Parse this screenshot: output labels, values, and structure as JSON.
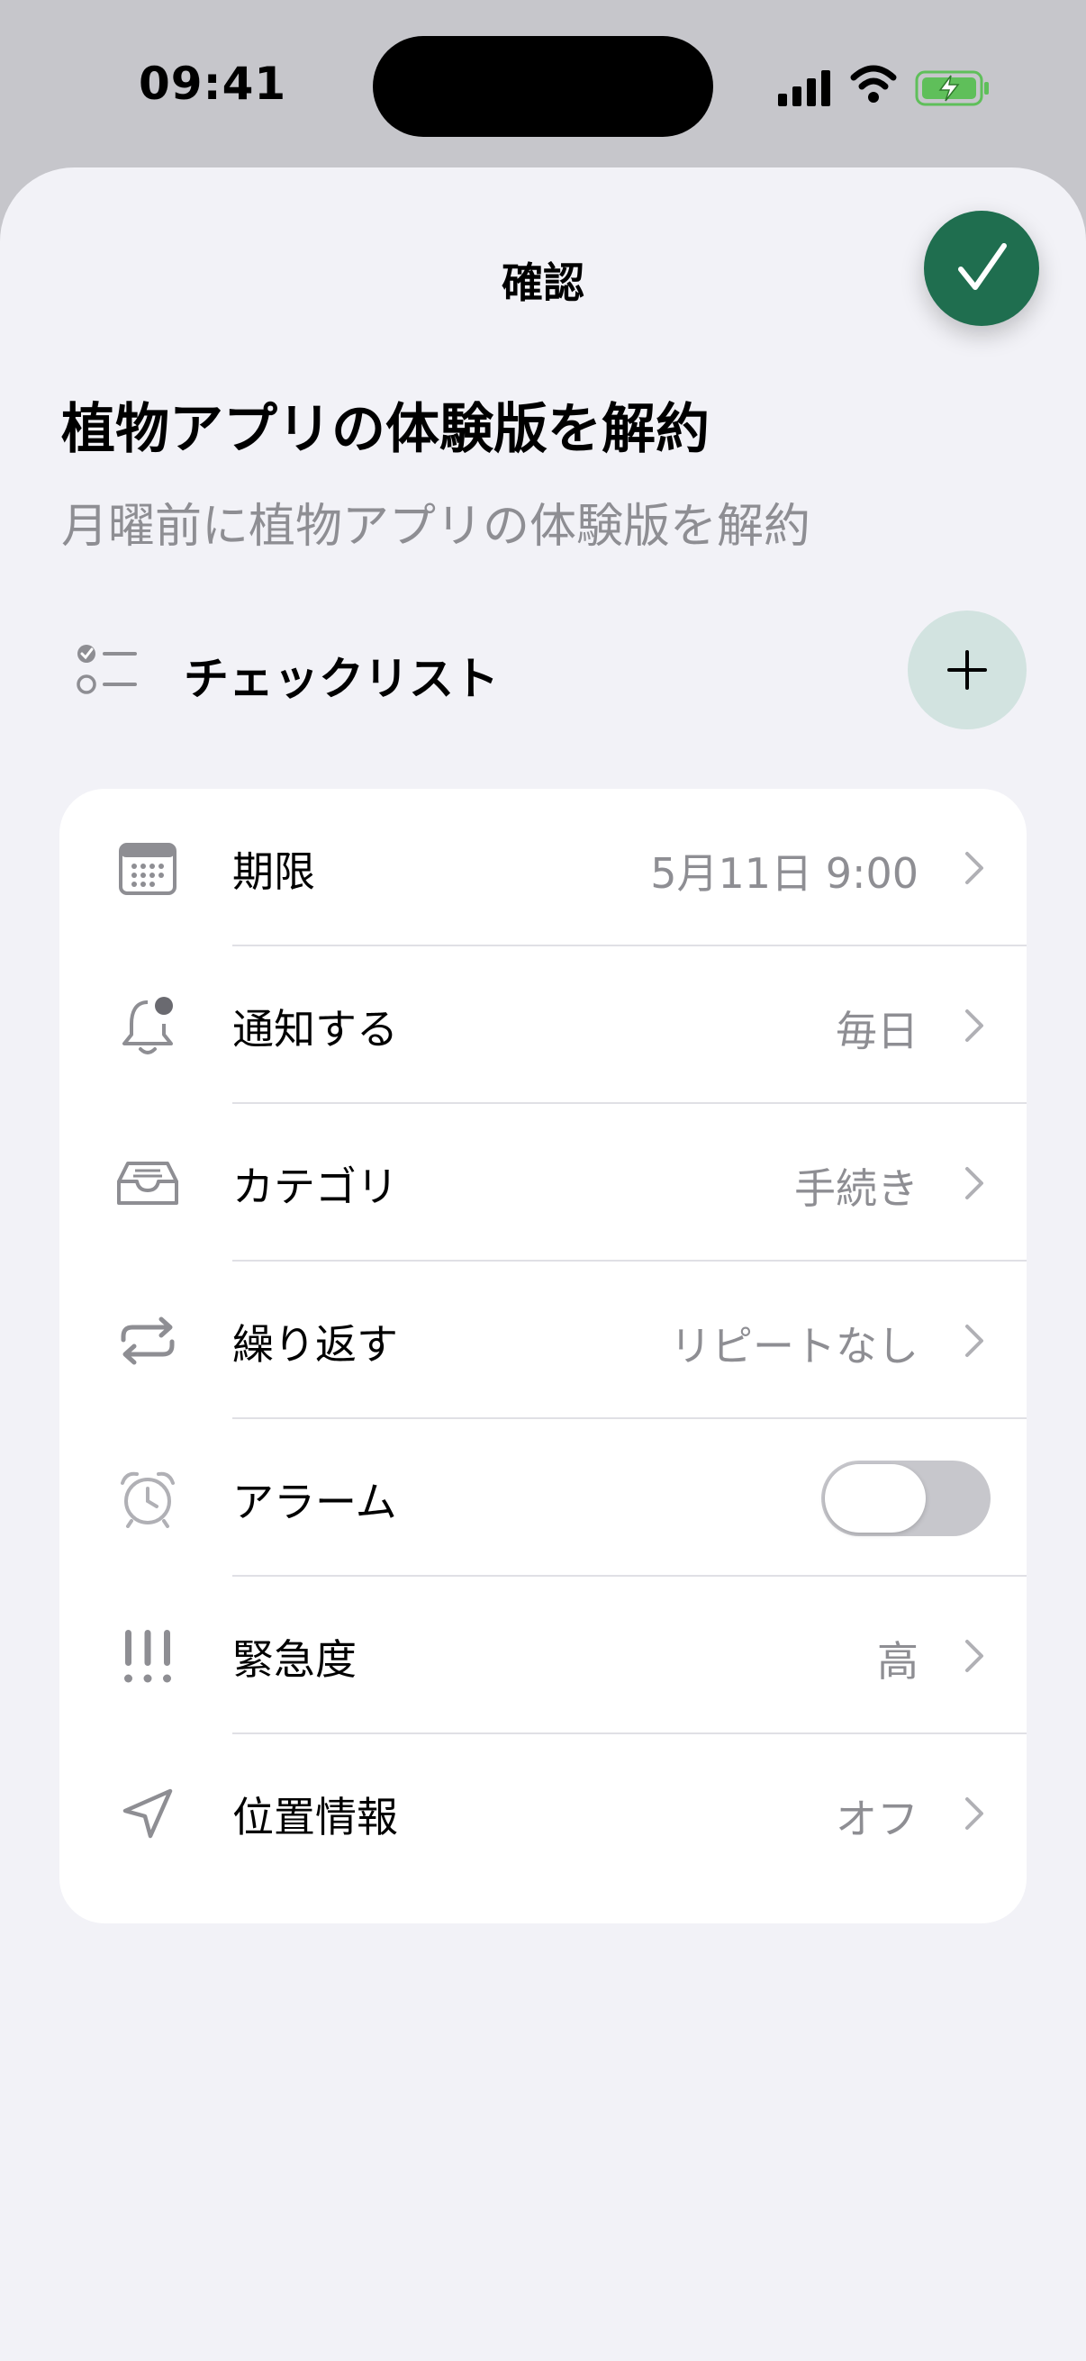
{
  "status_bar": {
    "time": "09:41"
  },
  "sheet": {
    "title": "確認",
    "task_title": "植物アプリの体験版を解約",
    "task_description": "月曜前に植物アプリの体験版を解約",
    "checklist_label": "チェックリスト"
  },
  "settings": [
    {
      "icon": "calendar-icon",
      "label": "期限",
      "value": "5月11日 9:00",
      "control": "chevron"
    },
    {
      "icon": "bell-badge-icon",
      "label": "通知する",
      "value": "毎日",
      "control": "chevron"
    },
    {
      "icon": "tray-icon",
      "label": "カテゴリ",
      "value": "手続き",
      "control": "chevron"
    },
    {
      "icon": "repeat-icon",
      "label": "繰り返す",
      "value": "リピートなし",
      "control": "chevron"
    },
    {
      "icon": "alarm-clock-icon",
      "label": "アラーム",
      "value": "",
      "control": "toggle",
      "toggle_on": false
    },
    {
      "icon": "exclamation-icon",
      "label": "緊急度",
      "value": "高",
      "control": "chevron"
    },
    {
      "icon": "location-arrow-icon",
      "label": "位置情報",
      "value": "オフ",
      "control": "chevron"
    }
  ],
  "colors": {
    "accent": "#1f6e4f",
    "add_button_bg": "#d2e3e0",
    "secondary_text": "#8e8e93",
    "sheet_background": "#f2f2f7"
  }
}
